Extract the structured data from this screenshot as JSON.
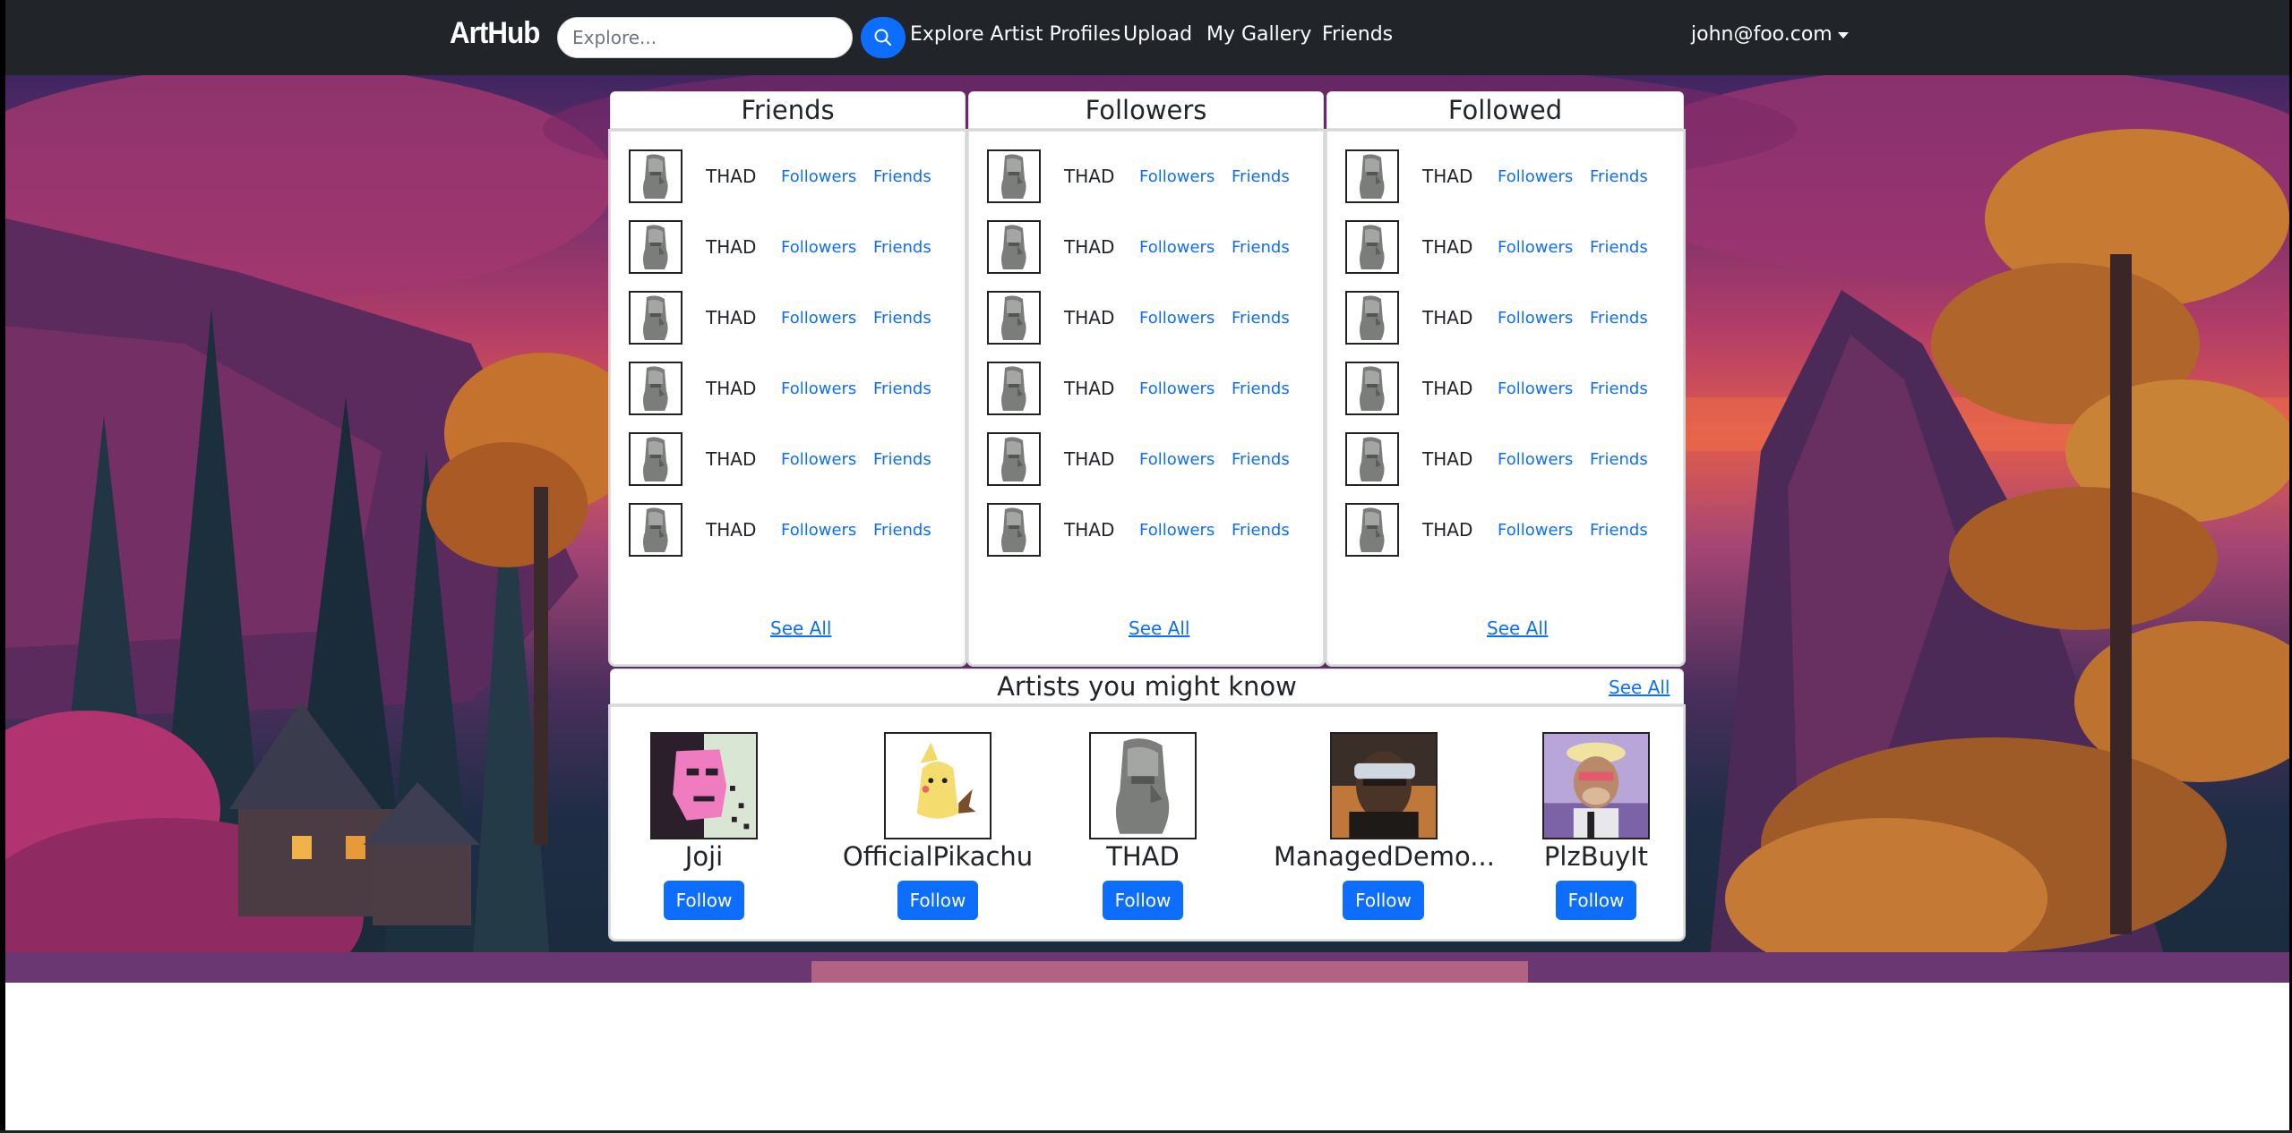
{
  "navbar": {
    "brand": "ArtHub",
    "search_placeholder": "Explore...",
    "links": [
      "Explore Artist Profiles",
      "Upload",
      "My Gallery",
      "Friends"
    ],
    "user": "john@foo.com"
  },
  "panels": {
    "friends": {
      "title": "Friends",
      "see_all": "See All",
      "rows": [
        {
          "name": "THAD",
          "followers": "Followers",
          "friends": "Friends"
        },
        {
          "name": "THAD",
          "followers": "Followers",
          "friends": "Friends"
        },
        {
          "name": "THAD",
          "followers": "Followers",
          "friends": "Friends"
        },
        {
          "name": "THAD",
          "followers": "Followers",
          "friends": "Friends"
        },
        {
          "name": "THAD",
          "followers": "Followers",
          "friends": "Friends"
        },
        {
          "name": "THAD",
          "followers": "Followers",
          "friends": "Friends"
        }
      ]
    },
    "followers": {
      "title": "Followers",
      "see_all": "See All",
      "rows": [
        {
          "name": "THAD",
          "followers": "Followers",
          "friends": "Friends"
        },
        {
          "name": "THAD",
          "followers": "Followers",
          "friends": "Friends"
        },
        {
          "name": "THAD",
          "followers": "Followers",
          "friends": "Friends"
        },
        {
          "name": "THAD",
          "followers": "Followers",
          "friends": "Friends"
        },
        {
          "name": "THAD",
          "followers": "Followers",
          "friends": "Friends"
        },
        {
          "name": "THAD",
          "followers": "Followers",
          "friends": "Friends"
        }
      ]
    },
    "followed": {
      "title": "Followed",
      "see_all": "See All",
      "rows": [
        {
          "name": "THAD",
          "followers": "Followers",
          "friends": "Friends"
        },
        {
          "name": "THAD",
          "followers": "Followers",
          "friends": "Friends"
        },
        {
          "name": "THAD",
          "followers": "Followers",
          "friends": "Friends"
        },
        {
          "name": "THAD",
          "followers": "Followers",
          "friends": "Friends"
        },
        {
          "name": "THAD",
          "followers": "Followers",
          "friends": "Friends"
        },
        {
          "name": "THAD",
          "followers": "Followers",
          "friends": "Friends"
        }
      ]
    }
  },
  "artists_section": {
    "title": "Artists you might know",
    "see_all": "See All",
    "follow_label": "Follow",
    "artists": [
      {
        "name": "Joji",
        "avatar": "pink-pixel-face"
      },
      {
        "name": "OfficialPikachu",
        "avatar": "yellow-costume-creature"
      },
      {
        "name": "THAD",
        "avatar": "stone-head"
      },
      {
        "name": "ManagedDemo...",
        "avatar": "helmet-portrait"
      },
      {
        "name": "PlzBuyIt",
        "avatar": "cartoon-ape"
      }
    ]
  },
  "colors": {
    "navbar": "#212529",
    "primary": "#0d6efd",
    "text": "#212529"
  }
}
